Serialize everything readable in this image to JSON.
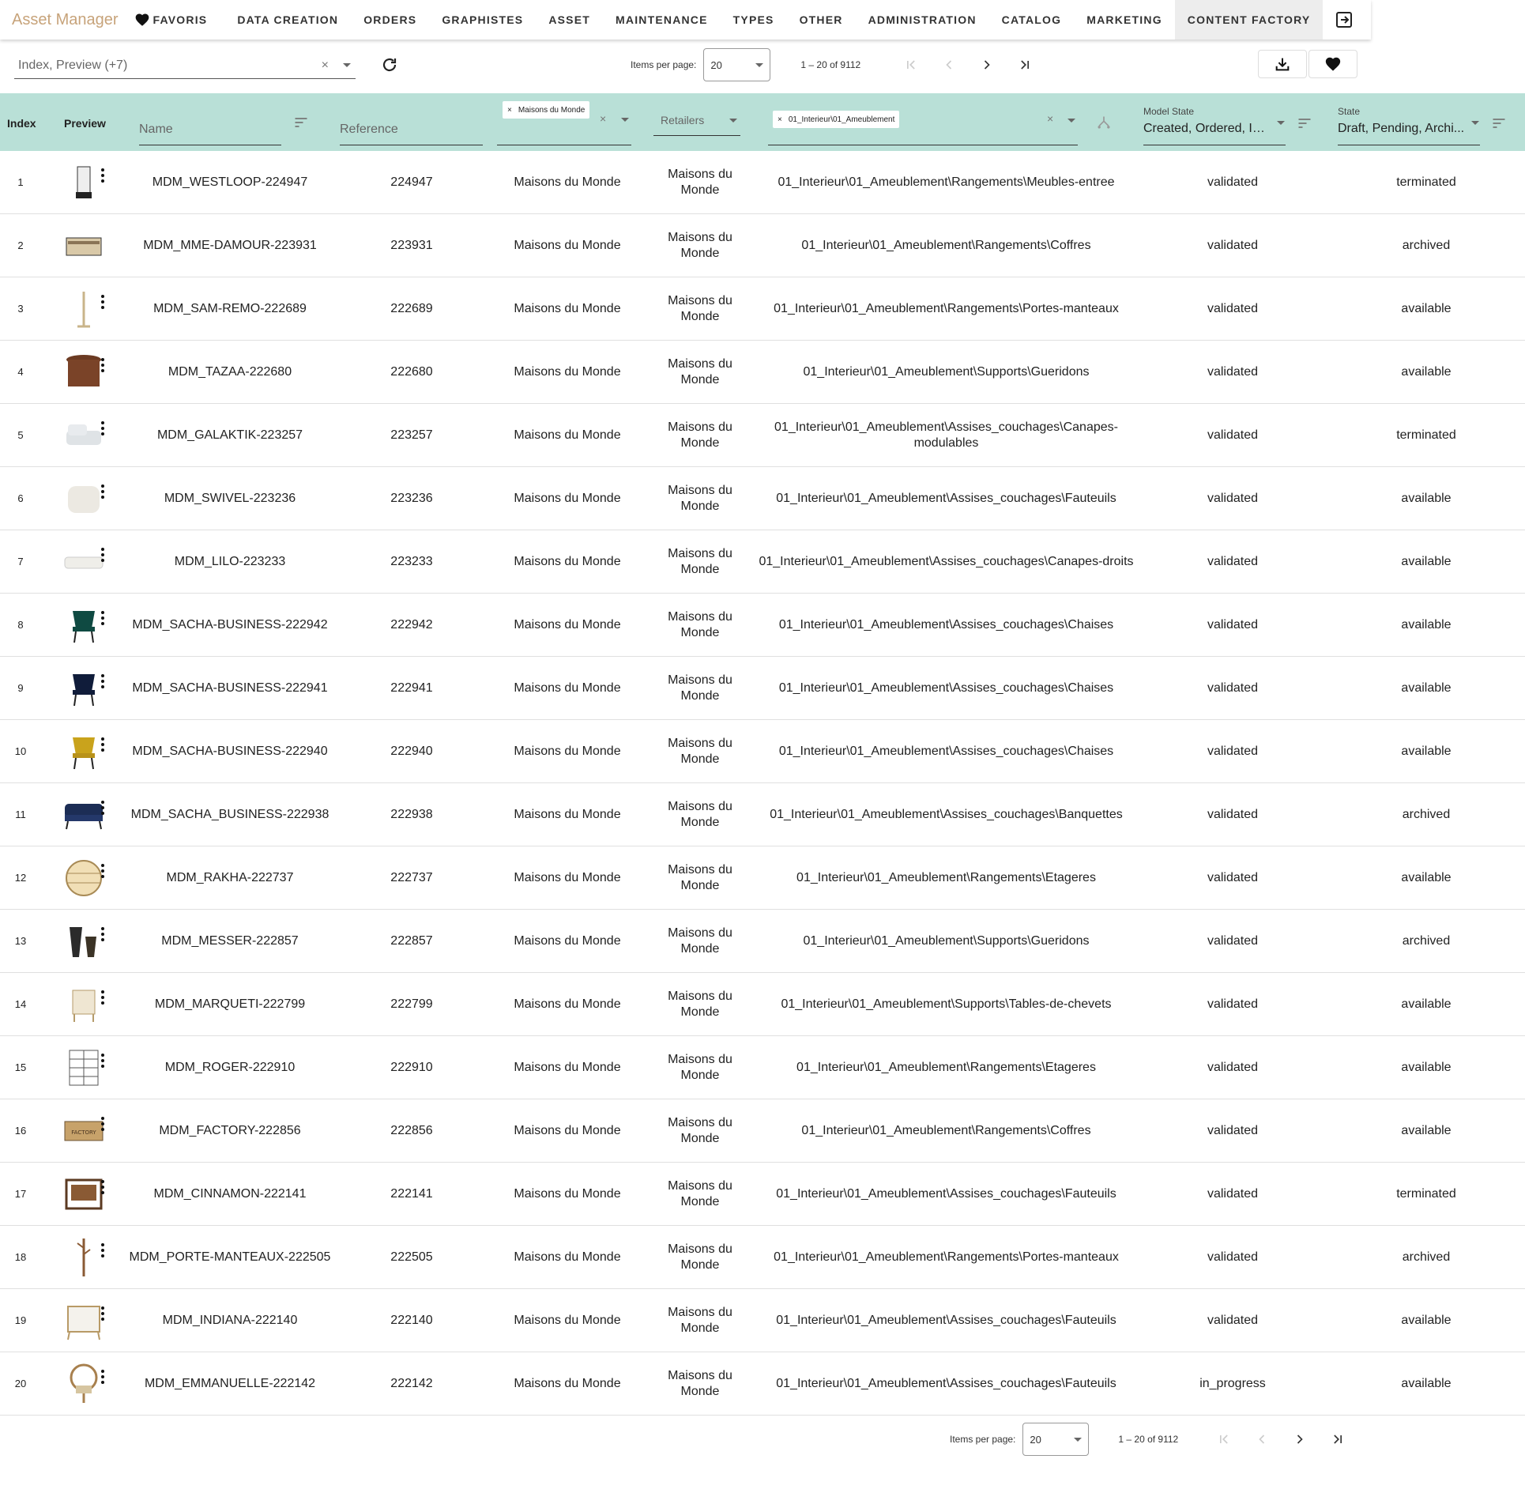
{
  "app": {
    "brand": "Asset Manager"
  },
  "nav": {
    "favoris": "FAVORIS",
    "items": [
      "DATA CREATION",
      "ORDERS",
      "GRAPHISTES",
      "ASSET",
      "MAINTENANCE",
      "TYPES",
      "OTHER",
      "ADMINISTRATION",
      "CATALOG",
      "MARKETING",
      "CONTENT FACTORY"
    ],
    "active": "CONTENT FACTORY"
  },
  "toolbar": {
    "columns_value": "Index, Preview (+7)",
    "clear_symbol": "×",
    "items_per_page_label": "Items per page:",
    "items_per_page": "20",
    "range": "1 – 20 of 9112"
  },
  "header": {
    "index": "Index",
    "preview": "Preview",
    "name_placeholder": "Name",
    "reference_placeholder": "Reference",
    "brand_chip": "Maisons du Monde",
    "retailers_placeholder": "Retailers",
    "path_chip": "01_Interieur\\01_Ameublement",
    "chip_x": "×",
    "model_state_label": "Model State",
    "model_state_value": "Created, Ordered, In ...",
    "state_label": "State",
    "state_value": "Draft, Pending, Archi..."
  },
  "rows": [
    {
      "index": "1",
      "name": "MDM_WESTLOOP-224947",
      "reference": "224947",
      "brand": "Maisons du Monde",
      "retailer": "Maisons du Monde",
      "path": "01_Interieur\\01_Ameublement\\Rangements\\Meubles-entree",
      "model_state": "validated",
      "state": "terminated",
      "icon": "entry-cabinet-icon"
    },
    {
      "index": "2",
      "name": "MDM_MME-DAMOUR-223931",
      "reference": "223931",
      "brand": "Maisons du Monde",
      "retailer": "Maisons du Monde",
      "path": "01_Interieur\\01_Ameublement\\Rangements\\Coffres",
      "model_state": "validated",
      "state": "archived",
      "icon": "chest-icon"
    },
    {
      "index": "3",
      "name": "MDM_SAM-REMO-222689",
      "reference": "222689",
      "brand": "Maisons du Monde",
      "retailer": "Maisons du Monde",
      "path": "01_Interieur\\01_Ameublement\\Rangements\\Portes-manteaux",
      "model_state": "validated",
      "state": "available",
      "icon": "coat-rack-icon"
    },
    {
      "index": "4",
      "name": "MDM_TAZAA-222680",
      "reference": "222680",
      "brand": "Maisons du Monde",
      "retailer": "Maisons du Monde",
      "path": "01_Interieur\\01_Ameublement\\Supports\\Gueridons",
      "model_state": "validated",
      "state": "available",
      "icon": "carved-table-icon"
    },
    {
      "index": "5",
      "name": "MDM_GALAKTIK-223257",
      "reference": "223257",
      "brand": "Maisons du Monde",
      "retailer": "Maisons du Monde",
      "path": "01_Interieur\\01_Ameublement\\Assises_couchages\\Canapes-modulables",
      "model_state": "validated",
      "state": "terminated",
      "icon": "modular-sofa-icon"
    },
    {
      "index": "6",
      "name": "MDM_SWIVEL-223236",
      "reference": "223236",
      "brand": "Maisons du Monde",
      "retailer": "Maisons du Monde",
      "path": "01_Interieur\\01_Ameublement\\Assises_couchages\\Fauteuils",
      "model_state": "validated",
      "state": "available",
      "icon": "armchair-icon"
    },
    {
      "index": "7",
      "name": "MDM_LILO-223233",
      "reference": "223233",
      "brand": "Maisons du Monde",
      "retailer": "Maisons du Monde",
      "path": "01_Interieur\\01_Ameublement\\Assises_couchages\\Canapes-droits",
      "model_state": "validated",
      "state": "available",
      "icon": "sofa-icon"
    },
    {
      "index": "8",
      "name": "MDM_SACHA-BUSINESS-222942",
      "reference": "222942",
      "brand": "Maisons du Monde",
      "retailer": "Maisons du Monde",
      "path": "01_Interieur\\01_Ameublement\\Assises_couchages\\Chaises",
      "model_state": "validated",
      "state": "available",
      "icon": "chair-green-icon"
    },
    {
      "index": "9",
      "name": "MDM_SACHA-BUSINESS-222941",
      "reference": "222941",
      "brand": "Maisons du Monde",
      "retailer": "Maisons du Monde",
      "path": "01_Interieur\\01_Ameublement\\Assises_couchages\\Chaises",
      "model_state": "validated",
      "state": "available",
      "icon": "chair-navy-icon"
    },
    {
      "index": "10",
      "name": "MDM_SACHA-BUSINESS-222940",
      "reference": "222940",
      "brand": "Maisons du Monde",
      "retailer": "Maisons du Monde",
      "path": "01_Interieur\\01_Ameublement\\Assises_couchages\\Chaises",
      "model_state": "validated",
      "state": "available",
      "icon": "chair-mustard-icon"
    },
    {
      "index": "11",
      "name": "MDM_SACHA_BUSINESS-222938",
      "reference": "222938",
      "brand": "Maisons du Monde",
      "retailer": "Maisons du Monde",
      "path": "01_Interieur\\01_Ameublement\\Assises_couchages\\Banquettes",
      "model_state": "validated",
      "state": "archived",
      "icon": "bench-icon"
    },
    {
      "index": "12",
      "name": "MDM_RAKHA-222737",
      "reference": "222737",
      "brand": "Maisons du Monde",
      "retailer": "Maisons du Monde",
      "path": "01_Interieur\\01_Ameublement\\Rangements\\Etageres",
      "model_state": "validated",
      "state": "available",
      "icon": "round-shelf-icon"
    },
    {
      "index": "13",
      "name": "MDM_MESSER-222857",
      "reference": "222857",
      "brand": "Maisons du Monde",
      "retailer": "Maisons du Monde",
      "path": "01_Interieur\\01_Ameublement\\Supports\\Gueridons",
      "model_state": "validated",
      "state": "archived",
      "icon": "side-tables-icon"
    },
    {
      "index": "14",
      "name": "MDM_MARQUETI-222799",
      "reference": "222799",
      "brand": "Maisons du Monde",
      "retailer": "Maisons du Monde",
      "path": "01_Interieur\\01_Ameublement\\Supports\\Tables-de-chevets",
      "model_state": "validated",
      "state": "available",
      "icon": "nightstand-icon"
    },
    {
      "index": "15",
      "name": "MDM_ROGER-222910",
      "reference": "222910",
      "brand": "Maisons du Monde",
      "retailer": "Maisons du Monde",
      "path": "01_Interieur\\01_Ameublement\\Rangements\\Etageres",
      "model_state": "validated",
      "state": "available",
      "icon": "bookshelf-icon"
    },
    {
      "index": "16",
      "name": "MDM_FACTORY-222856",
      "reference": "222856",
      "brand": "Maisons du Monde",
      "retailer": "Maisons du Monde",
      "path": "01_Interieur\\01_Ameublement\\Rangements\\Coffres",
      "model_state": "validated",
      "state": "available",
      "icon": "crate-chest-icon"
    },
    {
      "index": "17",
      "name": "MDM_CINNAMON-222141",
      "reference": "222141",
      "brand": "Maisons du Monde",
      "retailer": "Maisons du Monde",
      "path": "01_Interieur\\01_Ameublement\\Assises_couchages\\Fauteuils",
      "model_state": "validated",
      "state": "terminated",
      "icon": "leather-armchair-icon"
    },
    {
      "index": "18",
      "name": "MDM_PORTE-MANTEAUX-222505",
      "reference": "222505",
      "brand": "Maisons du Monde",
      "retailer": "Maisons du Monde",
      "path": "01_Interieur\\01_Ameublement\\Rangements\\Portes-manteaux",
      "model_state": "validated",
      "state": "archived",
      "icon": "branch-coat-rack-icon"
    },
    {
      "index": "19",
      "name": "MDM_INDIANA-222140",
      "reference": "222140",
      "brand": "Maisons du Monde",
      "retailer": "Maisons du Monde",
      "path": "01_Interieur\\01_Ameublement\\Assises_couchages\\Fauteuils",
      "model_state": "validated",
      "state": "available",
      "icon": "wood-armchair-icon"
    },
    {
      "index": "20",
      "name": "MDM_EMMANUELLE-222142",
      "reference": "222142",
      "brand": "Maisons du Monde",
      "retailer": "Maisons du Monde",
      "path": "01_Interieur\\01_Ameublement\\Assises_couchages\\Fauteuils",
      "model_state": "in_progress",
      "state": "available",
      "icon": "rattan-chair-icon"
    }
  ],
  "colors": {
    "header_bg": "#b9e0d7",
    "brand": "#c7a37a",
    "active_tab": "#ededed"
  }
}
